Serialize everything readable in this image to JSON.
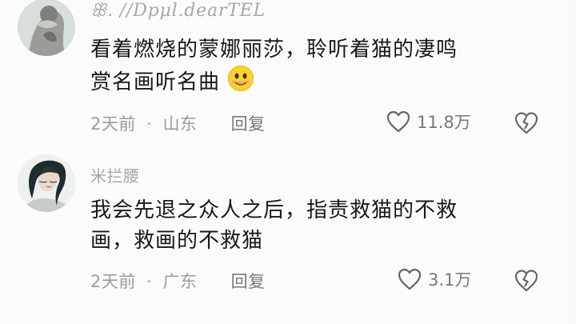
{
  "comments": [
    {
      "username": "ꕥ. //Dpμl.dearTEL",
      "line1": "看着燃烧的蒙娜丽莎，聆听着猫的凄鸣",
      "line2": "赏名画听名曲",
      "emoji": "smiling-face-icon",
      "time": "2天前",
      "separator": "·",
      "location": "山东",
      "reply_label": "回复",
      "like_count": "11.8万",
      "colors": {
        "avatar_bg": "#d8dedb",
        "avatar_figure": "#8e8f87"
      }
    },
    {
      "username": "米拦腰",
      "line1": "我会先退之众人之后，指责救猫的不救",
      "line2": "画，救画的不救猫",
      "time": "2天前",
      "separator": "·",
      "location": "广东",
      "reply_label": "回复",
      "like_count": "3.1万",
      "colors": {
        "avatar_bg": "#ecefed",
        "avatar_figure": "#1e2d2d"
      }
    }
  ],
  "icons": {
    "like": "heart-outline-icon",
    "dislike": "broken-heart-icon"
  }
}
